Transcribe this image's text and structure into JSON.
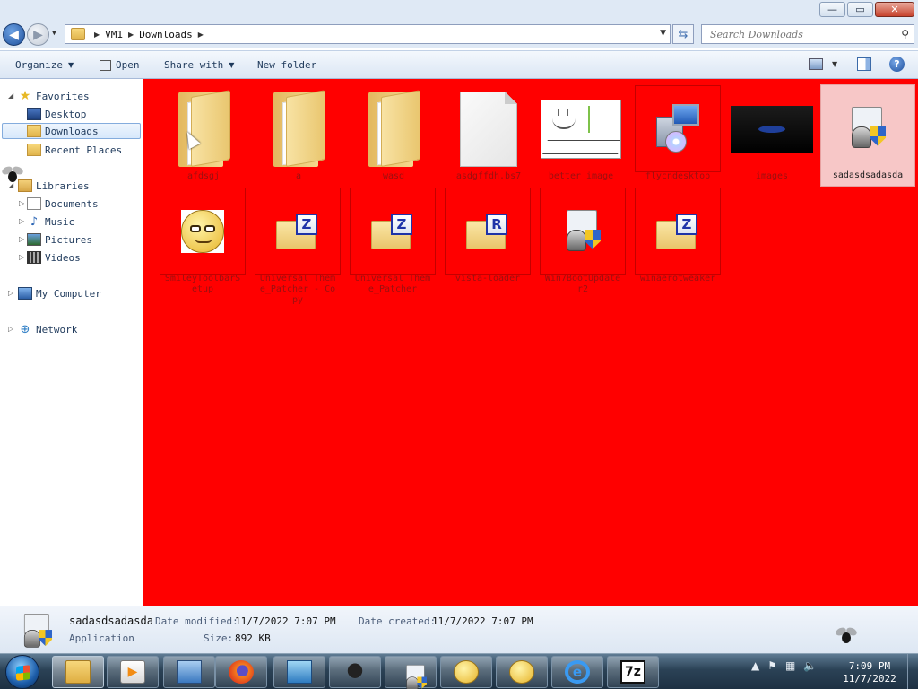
{
  "window": {
    "buttons": {
      "minimize": "—",
      "maximize": "▭",
      "close": "✕"
    }
  },
  "address": {
    "crumbs": [
      "VM1",
      "Downloads"
    ],
    "search_placeholder": "Search Downloads"
  },
  "toolbar": {
    "organize": "Organize",
    "open": "Open",
    "share_with": "Share with",
    "new_folder": "New folder",
    "help": "?"
  },
  "nav": {
    "favorites": "Favorites",
    "desktop": "Desktop",
    "downloads": "Downloads",
    "recent_places": "Recent Places",
    "libraries": "Libraries",
    "documents": "Documents",
    "music": "Music",
    "pictures": "Pictures",
    "videos": "Videos",
    "my_computer": "My Computer",
    "network": "Network"
  },
  "files": [
    {
      "name": "afdsgj",
      "kind": "folder"
    },
    {
      "name": "a",
      "kind": "folder"
    },
    {
      "name": "wasd",
      "kind": "folder"
    },
    {
      "name": "asdgffdh.bs7",
      "kind": "document"
    },
    {
      "name": "better image",
      "kind": "image"
    },
    {
      "name": "flycndesktop",
      "kind": "installer"
    },
    {
      "name": "images",
      "kind": "image-dark"
    },
    {
      "name": "sadasdsadasda",
      "kind": "application",
      "selected": true
    },
    {
      "name": "SmileyToolbarSetup",
      "kind": "smiley"
    },
    {
      "name": "Universal_Theme_Patcher - Copy",
      "kind": "zip-z"
    },
    {
      "name": "Universal_Theme_Patcher",
      "kind": "zip-z"
    },
    {
      "name": "vista-loader",
      "kind": "zip-r"
    },
    {
      "name": "Win7BootUpdater2",
      "kind": "application"
    },
    {
      "name": "winaerotweaker",
      "kind": "zip-z"
    }
  ],
  "details": {
    "name": "sadasdsadasda",
    "type": "Application",
    "date_modified_label": "Date modified:",
    "date_modified": "11/7/2022 7:07 PM",
    "date_created_label": "Date created:",
    "date_created": "11/7/2022 7:07 PM",
    "size_label": "Size:",
    "size": "892 KB"
  },
  "taskbar": {
    "seven_zip": "7z",
    "ie": "e",
    "time": "7:09 PM",
    "date": "11/7/2022"
  }
}
